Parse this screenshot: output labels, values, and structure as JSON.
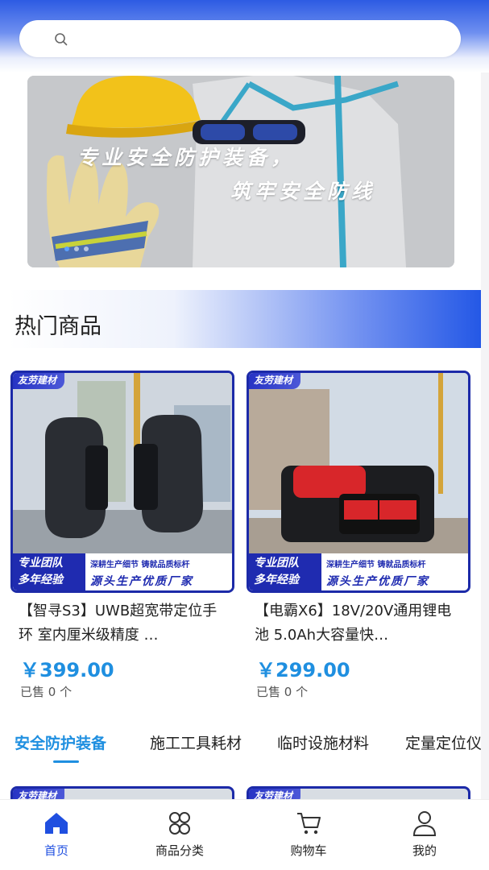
{
  "search": {
    "placeholder": ""
  },
  "banner": {
    "line1": "专业安全防护装备，",
    "line2": "筑牢安全防线",
    "slides": 3,
    "active_slide": 1
  },
  "hot_section": {
    "title": "热门商品"
  },
  "products": [
    {
      "tag": "友劳建材",
      "strip_left_1": "专业团队",
      "strip_left_2": "多年经验",
      "strip_top": "深耕生产细节 铸就品质标杆",
      "strip_bottom": "源头生产优质厂家",
      "name": "【智寻S3】UWB超宽带定位手环 室内厘米级精度 …",
      "price": "￥399.00",
      "sold": "已售 0 个"
    },
    {
      "tag": "友劳建材",
      "strip_left_1": "专业团队",
      "strip_left_2": "多年经验",
      "strip_top": "深耕生产细节 铸就品质标杆",
      "strip_bottom": "源头生产优质厂家",
      "name": "【电霸X6】18V/20V通用锂电池 5.0Ah大容量快…",
      "price": "￥299.00",
      "sold": "已售 0 个"
    }
  ],
  "category_tabs": [
    {
      "label": "安全防护装备",
      "active": true
    },
    {
      "label": "施工工具耗材",
      "active": false
    },
    {
      "label": "临时设施材料",
      "active": false
    },
    {
      "label": "定量定位仪",
      "active": false
    }
  ],
  "peek_cards": [
    {
      "tag": "友劳建材"
    },
    {
      "tag": "友劳建材"
    }
  ],
  "tabbar": [
    {
      "label": "首页",
      "icon": "home-icon",
      "active": true
    },
    {
      "label": "商品分类",
      "icon": "category-icon",
      "active": false
    },
    {
      "label": "购物车",
      "icon": "cart-icon",
      "active": false
    },
    {
      "label": "我的",
      "icon": "user-icon",
      "active": false
    }
  ],
  "colors": {
    "accent": "#1f8fe0",
    "brand_blue": "#2458e6",
    "active_tab": "#1f4fe0"
  }
}
